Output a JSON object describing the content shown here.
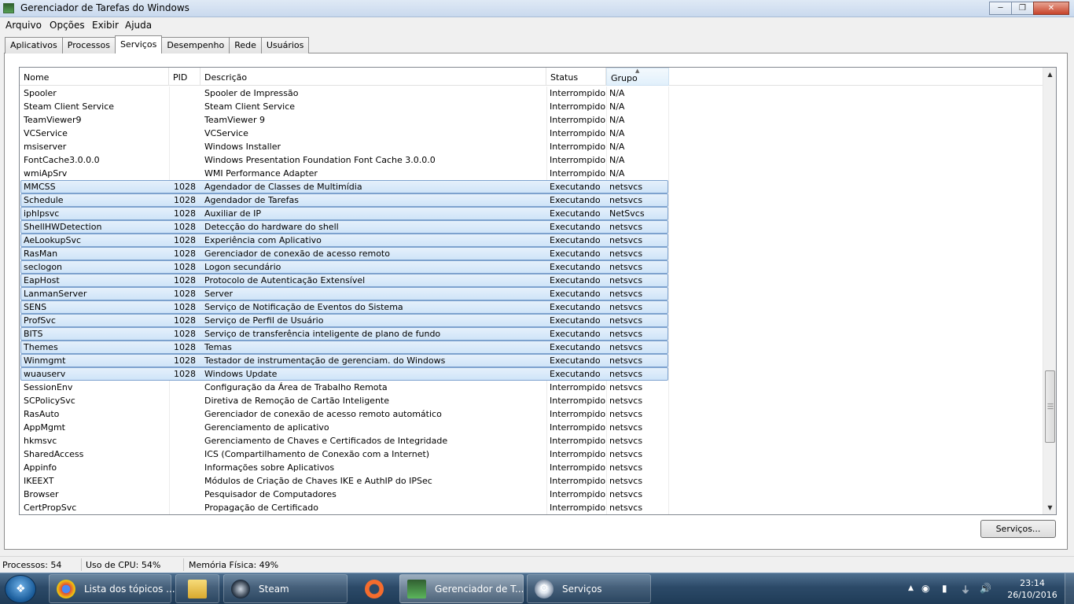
{
  "window": {
    "title": "Gerenciador de Tarefas do Windows"
  },
  "menu": [
    "Arquivo",
    "Opções",
    "Exibir",
    "Ajuda"
  ],
  "tabs": [
    "Aplicativos",
    "Processos",
    "Serviços",
    "Desempenho",
    "Rede",
    "Usuários"
  ],
  "active_tab": "Serviços",
  "table": {
    "columns": [
      "Nome",
      "PID",
      "Descrição",
      "Status",
      "Grupo"
    ],
    "sorted_column": "Grupo",
    "rows": [
      {
        "name": "Spooler",
        "pid": "",
        "desc": "Spooler de Impressão",
        "status": "Interrompido",
        "group": "N/A"
      },
      {
        "name": "Steam Client Service",
        "pid": "",
        "desc": "Steam Client Service",
        "status": "Interrompido",
        "group": "N/A"
      },
      {
        "name": "TeamViewer9",
        "pid": "",
        "desc": "TeamViewer 9",
        "status": "Interrompido",
        "group": "N/A"
      },
      {
        "name": "VCService",
        "pid": "",
        "desc": "VCService",
        "status": "Interrompido",
        "group": "N/A"
      },
      {
        "name": "msiserver",
        "pid": "",
        "desc": "Windows Installer",
        "status": "Interrompido",
        "group": "N/A"
      },
      {
        "name": "FontCache3.0.0.0",
        "pid": "",
        "desc": "Windows Presentation Foundation Font Cache 3.0.0.0",
        "status": "Interrompido",
        "group": "N/A"
      },
      {
        "name": "wmiApSrv",
        "pid": "",
        "desc": "WMI Performance Adapter",
        "status": "Interrompido",
        "group": "N/A"
      },
      {
        "name": "MMCSS",
        "pid": "1028",
        "desc": "Agendador de Classes de Multimídia",
        "status": "Executando",
        "group": "netsvcs"
      },
      {
        "name": "Schedule",
        "pid": "1028",
        "desc": "Agendador de Tarefas",
        "status": "Executando",
        "group": "netsvcs"
      },
      {
        "name": "iphlpsvc",
        "pid": "1028",
        "desc": "Auxiliar de IP",
        "status": "Executando",
        "group": "NetSvcs"
      },
      {
        "name": "ShellHWDetection",
        "pid": "1028",
        "desc": "Detecção do hardware do shell",
        "status": "Executando",
        "group": "netsvcs"
      },
      {
        "name": "AeLookupSvc",
        "pid": "1028",
        "desc": "Experiência com Aplicativo",
        "status": "Executando",
        "group": "netsvcs"
      },
      {
        "name": "RasMan",
        "pid": "1028",
        "desc": "Gerenciador de conexão de acesso remoto",
        "status": "Executando",
        "group": "netsvcs"
      },
      {
        "name": "seclogon",
        "pid": "1028",
        "desc": "Logon secundário",
        "status": "Executando",
        "group": "netsvcs"
      },
      {
        "name": "EapHost",
        "pid": "1028",
        "desc": "Protocolo de Autenticação Extensível",
        "status": "Executando",
        "group": "netsvcs"
      },
      {
        "name": "LanmanServer",
        "pid": "1028",
        "desc": "Server",
        "status": "Executando",
        "group": "netsvcs"
      },
      {
        "name": "SENS",
        "pid": "1028",
        "desc": "Serviço de Notificação de Eventos do Sistema",
        "status": "Executando",
        "group": "netsvcs"
      },
      {
        "name": "ProfSvc",
        "pid": "1028",
        "desc": "Serviço de Perfil de Usuário",
        "status": "Executando",
        "group": "netsvcs"
      },
      {
        "name": "BITS",
        "pid": "1028",
        "desc": "Serviço de transferência inteligente de plano de fundo",
        "status": "Executando",
        "group": "netsvcs"
      },
      {
        "name": "Themes",
        "pid": "1028",
        "desc": "Temas",
        "status": "Executando",
        "group": "netsvcs"
      },
      {
        "name": "Winmgmt",
        "pid": "1028",
        "desc": "Testador de instrumentação de gerenciam. do Windows",
        "status": "Executando",
        "group": "netsvcs"
      },
      {
        "name": "wuauserv",
        "pid": "1028",
        "desc": "Windows Update",
        "status": "Executando",
        "group": "netsvcs"
      },
      {
        "name": "SessionEnv",
        "pid": "",
        "desc": "Configuração da Área de Trabalho Remota",
        "status": "Interrompido",
        "group": "netsvcs"
      },
      {
        "name": "SCPolicySvc",
        "pid": "",
        "desc": "Diretiva de Remoção de Cartão Inteligente",
        "status": "Interrompido",
        "group": "netsvcs"
      },
      {
        "name": "RasAuto",
        "pid": "",
        "desc": "Gerenciador de conexão de acesso remoto automático",
        "status": "Interrompido",
        "group": "netsvcs"
      },
      {
        "name": "AppMgmt",
        "pid": "",
        "desc": "Gerenciamento de aplicativo",
        "status": "Interrompido",
        "group": "netsvcs"
      },
      {
        "name": "hkmsvc",
        "pid": "",
        "desc": "Gerenciamento de Chaves e Certificados de Integridade",
        "status": "Interrompido",
        "group": "netsvcs"
      },
      {
        "name": "SharedAccess",
        "pid": "",
        "desc": "ICS (Compartilhamento de Conexão com a Internet)",
        "status": "Interrompido",
        "group": "netsvcs"
      },
      {
        "name": "Appinfo",
        "pid": "",
        "desc": "Informações sobre Aplicativos",
        "status": "Interrompido",
        "group": "netsvcs"
      },
      {
        "name": "IKEEXT",
        "pid": "",
        "desc": "Módulos de Criação de Chaves IKE e AuthIP do IPSec",
        "status": "Interrompido",
        "group": "netsvcs"
      },
      {
        "name": "Browser",
        "pid": "",
        "desc": "Pesquisador de Computadores",
        "status": "Interrompido",
        "group": "netsvcs"
      },
      {
        "name": "CertPropSvc",
        "pid": "",
        "desc": "Propagação de Certificado",
        "status": "Interrompido",
        "group": "netsvcs"
      }
    ]
  },
  "services_button": "Serviços...",
  "statusbar": {
    "processes": "Processos: 54",
    "cpu": "Uso de CPU: 54%",
    "memory": "Memória Física: 49%"
  },
  "taskbar": {
    "items": [
      {
        "label": "Lista dos tópicos ...",
        "icon": "chrome-icon"
      },
      {
        "label": "",
        "icon": "folder-icon"
      },
      {
        "label": "Steam",
        "icon": "steam-icon"
      },
      {
        "label": "",
        "icon": "origin-icon"
      },
      {
        "label": "Gerenciador de T...",
        "icon": "task-manager-icon"
      },
      {
        "label": "Serviços",
        "icon": "services-gear-icon"
      }
    ],
    "clock_time": "23:14",
    "clock_date": "26/10/2016"
  },
  "colors": {
    "running_row_bg": "#d9e8f8",
    "running_row_border": "#7da2ce",
    "taskbar": "#2c4a68"
  }
}
